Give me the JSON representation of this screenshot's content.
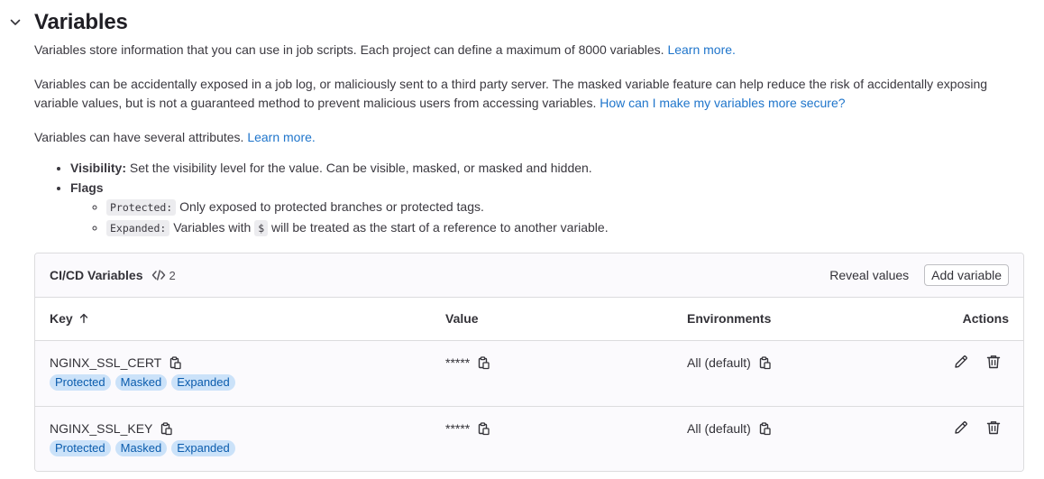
{
  "section": {
    "title": "Variables",
    "p1": "Variables store information that you can use in job scripts. Each project can define a maximum of 8000 variables.",
    "p1_link": "Learn more.",
    "p2": "Variables can be accidentally exposed in a job log, or maliciously sent to a third party server. The masked variable feature can help reduce the risk of accidentally exposing variable values, but is not a guaranteed method to prevent malicious users from accessing variables.",
    "p2_link": "How can I make my variables more secure?",
    "p3": "Variables can have several attributes.",
    "p3_link": "Learn more.",
    "attr_visibility_label": "Visibility:",
    "attr_visibility_text": "Set the visibility level for the value. Can be visible, masked, or masked and hidden.",
    "attr_flags_label": "Flags",
    "flag_protected_code": "Protected:",
    "flag_protected_text": "Only exposed to protected branches or protected tags.",
    "flag_expanded_code": "Expanded:",
    "flag_expanded_pre": "Variables with",
    "flag_expanded_symbol": "$",
    "flag_expanded_post": "will be treated as the start of a reference to another variable."
  },
  "card": {
    "title": "CI/CD Variables",
    "count": "2",
    "reveal_label": "Reveal values",
    "add_label": "Add variable"
  },
  "table": {
    "columns": {
      "key": "Key",
      "value": "Value",
      "environments": "Environments",
      "actions": "Actions"
    },
    "rows": [
      {
        "key": "NGINX_SSL_CERT",
        "value": "*****",
        "env": "All (default)",
        "badges": [
          "Protected",
          "Masked",
          "Expanded"
        ]
      },
      {
        "key": "NGINX_SSL_KEY",
        "value": "*****",
        "env": "All (default)",
        "badges": [
          "Protected",
          "Masked",
          "Expanded"
        ]
      }
    ]
  },
  "colors": {
    "link": "#1f75cb",
    "badge_bg": "#cbe2f9",
    "badge_text": "#0b5cad",
    "border": "#dcdcde"
  },
  "icons": [
    "chevron-down-icon",
    "code-icon",
    "sort-arrow-up-icon",
    "copy-icon",
    "pencil-icon",
    "trash-icon"
  ]
}
